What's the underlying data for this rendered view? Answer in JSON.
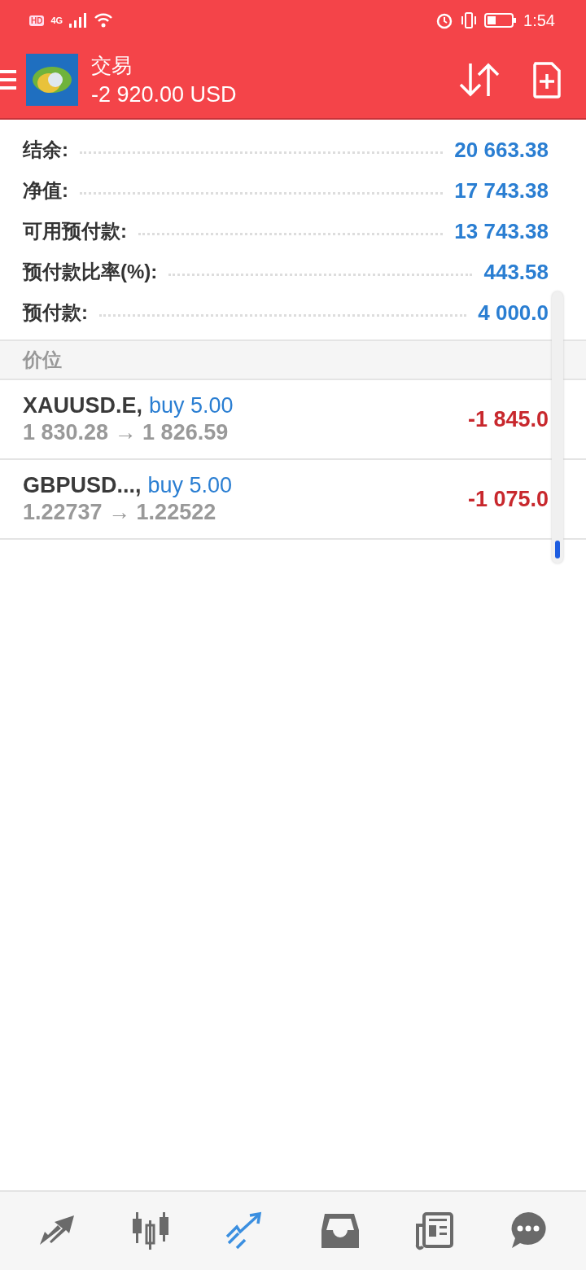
{
  "status_bar": {
    "hd": "HD",
    "network": "4G",
    "time": "1:54"
  },
  "toolbar": {
    "title": "交易",
    "balance": "-2 920.00 USD"
  },
  "account": [
    {
      "label": "结余:",
      "value": "20 663.38"
    },
    {
      "label": "净值:",
      "value": "17 743.38"
    },
    {
      "label": "可用预付款:",
      "value": "13 743.38"
    },
    {
      "label": "预付款比率(%):",
      "value": "443.58"
    },
    {
      "label": "预付款:",
      "value": "4 000.0"
    }
  ],
  "section": {
    "title": "价位"
  },
  "positions": [
    {
      "symbol": "XAUUSD.E,",
      "order": "buy 5.00",
      "prices": "1 830.28 → 1 826.59",
      "profit": "-1 845.0"
    },
    {
      "symbol": "GBPUSD...,",
      "order": "buy 5.00",
      "prices": "1.22737 → 1.22522",
      "profit": "-1 075.0"
    }
  ],
  "nav": [
    {
      "kind": "quotes",
      "selected": false
    },
    {
      "kind": "chart",
      "selected": false
    },
    {
      "kind": "trade",
      "selected": true
    },
    {
      "kind": "history",
      "selected": false
    },
    {
      "kind": "news",
      "selected": false
    },
    {
      "kind": "chat",
      "selected": false
    }
  ]
}
